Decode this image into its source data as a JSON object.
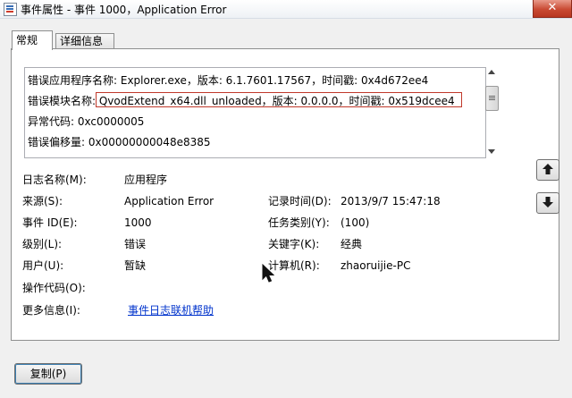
{
  "window": {
    "title": "事件属性 - 事件 1000，Application Error",
    "close_glyph": "✕"
  },
  "tabs": [
    {
      "label": "常规",
      "active": true
    },
    {
      "label": "详细信息",
      "active": false
    }
  ],
  "description": {
    "lines": [
      "错误应用程序名称: Explorer.exe，版本: 6.1.7601.17567，时间戳: 0x4d672ee4",
      "错误模块名称: QvodExtend_x64.dll_unloaded，版本: 0.0.0.0，时间戳: 0x519dcee4",
      "异常代码: 0xc0000005",
      "错误偏移量: 0x00000000048e8385"
    ],
    "highlight_color": "#c0392b"
  },
  "fields": {
    "log_name": {
      "label": "日志名称(M):",
      "value": "应用程序"
    },
    "source": {
      "label": "来源(S):",
      "value": "Application Error"
    },
    "logged": {
      "label": "记录时间(D):",
      "value": "2013/9/7 15:47:18"
    },
    "event_id": {
      "label": "事件 ID(E):",
      "value": "1000"
    },
    "task_category": {
      "label": "任务类别(Y):",
      "value": "(100)"
    },
    "level": {
      "label": "级别(L):",
      "value": "错误"
    },
    "keywords": {
      "label": "关键字(K):",
      "value": "经典"
    },
    "user": {
      "label": "用户(U):",
      "value": "暂缺"
    },
    "computer": {
      "label": "计算机(R):",
      "value": "zhaoruijie-PC"
    },
    "opcode": {
      "label": "操作代码(O):",
      "value": ""
    },
    "more_info": {
      "label": "更多信息(I):",
      "value": "事件日志联机帮助"
    }
  },
  "buttons": {
    "copy": "复制(P)",
    "nav_up_icon": "arrow-up-icon",
    "nav_down_icon": "arrow-down-icon"
  },
  "colors": {
    "link": "#0033cc",
    "close_button": "#c94a33"
  }
}
